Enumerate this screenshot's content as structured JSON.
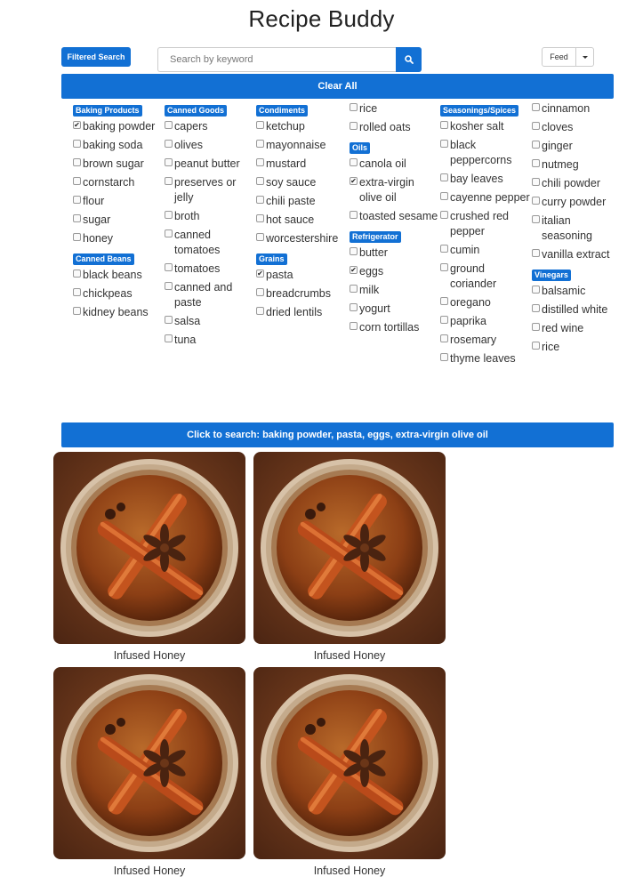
{
  "header": {
    "title": "Recipe Buddy"
  },
  "toolbar": {
    "filtered_search_label": "Filtered Search",
    "search_placeholder": "Search by keyword",
    "search_icon": "search-icon",
    "feed_label": "Feed",
    "clear_all_label": "Clear All"
  },
  "columns": [
    {
      "groups": [
        {
          "category": "Baking Products",
          "items": [
            {
              "label": "baking powder",
              "checked": true
            },
            {
              "label": "baking soda",
              "checked": false
            },
            {
              "label": "brown sugar",
              "checked": false
            },
            {
              "label": "cornstarch",
              "checked": false
            },
            {
              "label": "flour",
              "checked": false
            },
            {
              "label": "sugar",
              "checked": false
            },
            {
              "label": "honey",
              "checked": false
            }
          ]
        },
        {
          "category": "Canned Beans",
          "items": [
            {
              "label": "black beans",
              "checked": false
            },
            {
              "label": "chickpeas",
              "checked": false
            },
            {
              "label": "kidney beans",
              "checked": false
            }
          ]
        }
      ]
    },
    {
      "groups": [
        {
          "category": "Canned Goods",
          "items": [
            {
              "label": "capers",
              "checked": false
            },
            {
              "label": "olives",
              "checked": false
            },
            {
              "label": "peanut butter",
              "checked": false
            },
            {
              "label": "preserves or jelly",
              "checked": false
            },
            {
              "label": "broth",
              "checked": false
            },
            {
              "label": "canned tomatoes",
              "checked": false
            },
            {
              "label": "tomatoes",
              "checked": false
            },
            {
              "label": "canned and paste",
              "checked": false
            },
            {
              "label": "salsa",
              "checked": false
            },
            {
              "label": "tuna",
              "checked": false
            }
          ]
        }
      ]
    },
    {
      "groups": [
        {
          "category": "Condiments",
          "items": [
            {
              "label": "ketchup",
              "checked": false
            },
            {
              "label": "mayonnaise",
              "checked": false
            },
            {
              "label": "mustard",
              "checked": false
            },
            {
              "label": "soy sauce",
              "checked": false
            },
            {
              "label": "chili paste",
              "checked": false
            },
            {
              "label": "hot sauce",
              "checked": false
            },
            {
              "label": "worcestershire",
              "checked": false
            }
          ]
        },
        {
          "category": "Grains",
          "items": [
            {
              "label": "pasta",
              "checked": true
            },
            {
              "label": "breadcrumbs",
              "checked": false
            },
            {
              "label": "dried lentils",
              "checked": false
            }
          ]
        }
      ]
    },
    {
      "groups": [
        {
          "category": "",
          "items": [
            {
              "label": "rice",
              "checked": false
            },
            {
              "label": "rolled oats",
              "checked": false
            }
          ]
        },
        {
          "category": "Oils",
          "items": [
            {
              "label": "canola oil",
              "checked": false
            },
            {
              "label": "extra-virgin olive oil",
              "checked": true
            },
            {
              "label": "toasted sesame",
              "checked": false
            }
          ]
        },
        {
          "category": "Refrigerator",
          "items": [
            {
              "label": "butter",
              "checked": false
            },
            {
              "label": "eggs",
              "checked": true
            },
            {
              "label": "milk",
              "checked": false
            },
            {
              "label": "yogurt",
              "checked": false
            },
            {
              "label": "corn tortillas",
              "checked": false
            }
          ]
        }
      ]
    },
    {
      "groups": [
        {
          "category": "Seasonings/Spices",
          "items": [
            {
              "label": "kosher salt",
              "checked": false
            },
            {
              "label": "black peppercorns",
              "checked": false
            },
            {
              "label": "bay leaves",
              "checked": false
            },
            {
              "label": "cayenne pepper",
              "checked": false
            },
            {
              "label": "crushed red pepper",
              "checked": false
            },
            {
              "label": "cumin",
              "checked": false
            },
            {
              "label": "ground coriander",
              "checked": false
            },
            {
              "label": "oregano",
              "checked": false
            },
            {
              "label": "paprika",
              "checked": false
            },
            {
              "label": "rosemary",
              "checked": false
            },
            {
              "label": "thyme leaves",
              "checked": false
            }
          ]
        }
      ]
    },
    {
      "groups": [
        {
          "category": "",
          "items": [
            {
              "label": "cinnamon",
              "checked": false
            },
            {
              "label": "cloves",
              "checked": false
            },
            {
              "label": "ginger",
              "checked": false
            },
            {
              "label": "nutmeg",
              "checked": false
            },
            {
              "label": "chili powder",
              "checked": false
            },
            {
              "label": "curry powder",
              "checked": false
            },
            {
              "label": "italian seasoning",
              "checked": false
            },
            {
              "label": "vanilla extract",
              "checked": false
            }
          ]
        },
        {
          "category": "Vinegars",
          "items": [
            {
              "label": "balsamic",
              "checked": false
            },
            {
              "label": "distilled white",
              "checked": false
            },
            {
              "label": "red wine",
              "checked": false
            },
            {
              "label": "rice",
              "checked": false
            }
          ]
        }
      ]
    }
  ],
  "search_button_label": "Click to search: baking powder, pasta, eggs, extra-virgin olive oil",
  "results": [
    {
      "title": "Infused Honey"
    },
    {
      "title": "Infused Honey"
    },
    {
      "title": "Infused Honey"
    },
    {
      "title": "Infused Honey"
    }
  ],
  "colors": {
    "accent": "#1270d4"
  }
}
